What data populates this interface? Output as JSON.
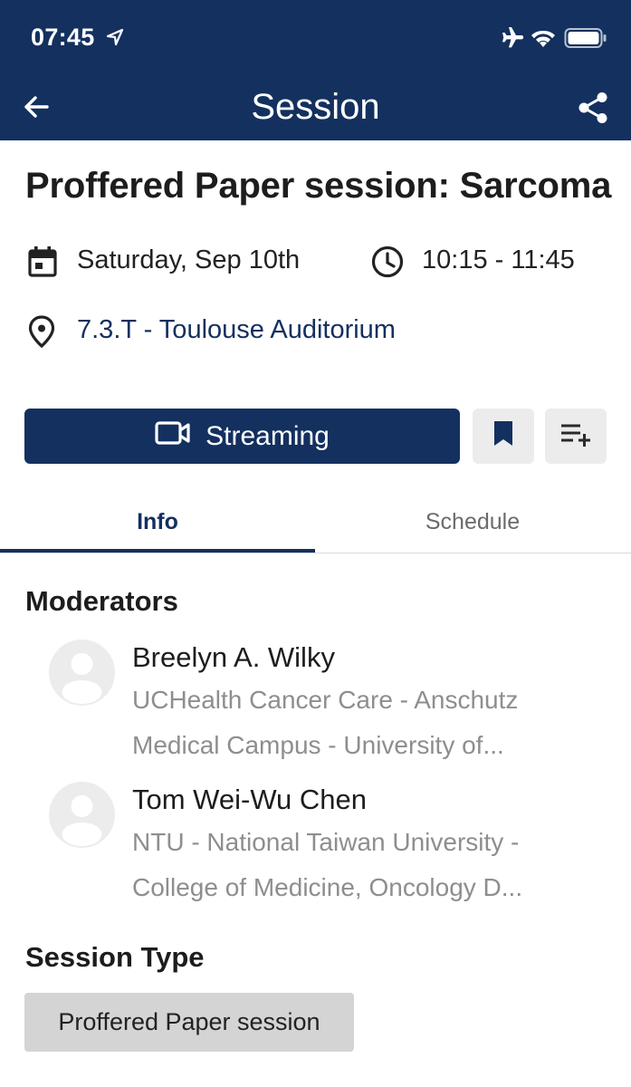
{
  "status_bar": {
    "time": "07:45"
  },
  "header": {
    "title": "Session"
  },
  "session": {
    "title": "Proffered Paper session: Sarcoma",
    "date": "Saturday, Sep 10th",
    "time": "10:15 - 11:45",
    "location": "7.3.T - Toulouse Auditorium"
  },
  "actions": {
    "streaming_label": "Streaming"
  },
  "tabs": [
    {
      "label": "Info",
      "active": true
    },
    {
      "label": "Schedule",
      "active": false
    }
  ],
  "moderators": {
    "heading": "Moderators",
    "people": [
      {
        "name": "Breelyn A. Wilky",
        "affiliation_line1": "UCHealth Cancer Care - Anschutz",
        "affiliation_line2": "Medical Campus - University of..."
      },
      {
        "name": "Tom Wei-Wu Chen",
        "affiliation_line1": "NTU - National Taiwan University -",
        "affiliation_line2": "College of Medicine, Oncology D..."
      }
    ]
  },
  "session_type": {
    "heading": "Session Type",
    "value": "Proffered Paper session"
  },
  "colors": {
    "brand": "#13305f",
    "chip": "#d4d4d4",
    "muted": "#8e8e8e"
  },
  "icons": [
    "location-arrow-icon",
    "airplane-icon",
    "wifi-icon",
    "battery-icon",
    "back-arrow-icon",
    "share-icon",
    "calendar-icon",
    "clock-icon",
    "map-pin-icon",
    "video-camera-icon",
    "bookmark-icon",
    "playlist-add-icon",
    "person-icon"
  ]
}
